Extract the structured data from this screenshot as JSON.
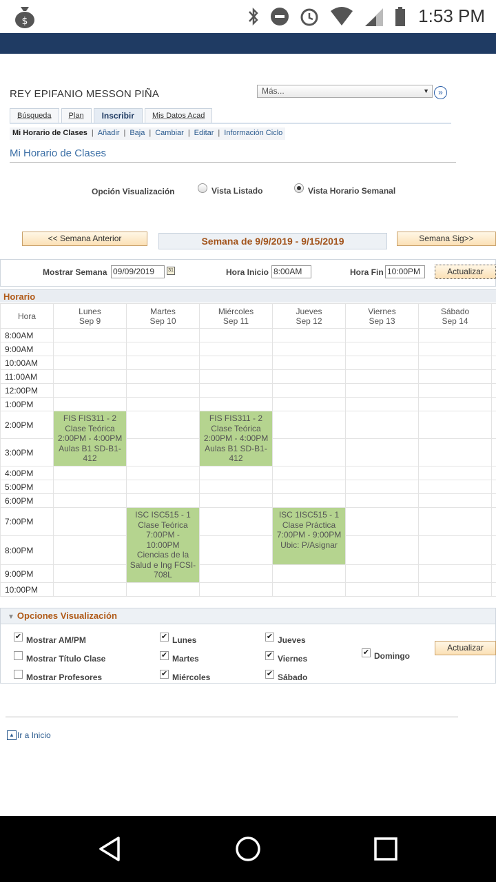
{
  "status_bar": {
    "time": "1:53 PM",
    "icons": [
      "money-bag-icon",
      "bluetooth-icon",
      "do-not-disturb-icon",
      "alarm-icon",
      "wifi-icon",
      "signal-icon",
      "battery-icon"
    ]
  },
  "student": {
    "name": "REY EPIFANIO MESSON PIÑA"
  },
  "mas_select": {
    "value": "Más...",
    "go": "»"
  },
  "tabs": [
    {
      "label": "Búsqueda",
      "active": false
    },
    {
      "label": "Plan",
      "active": false
    },
    {
      "label": "Inscribir",
      "active": true
    },
    {
      "label": "Mis Datos Acad",
      "active": false
    }
  ],
  "subnav": {
    "current": "Mi Horario de Clases",
    "links": [
      "Añadir",
      "Baja",
      "Cambiar",
      "Editar",
      "Información Ciclo"
    ],
    "separator": "|"
  },
  "page_title": "Mi Horario de Clases",
  "view_options": {
    "label": "Opción Visualización",
    "list": "Vista Listado",
    "weekly": "Vista Horario Semanal",
    "selected": "weekly"
  },
  "week_nav": {
    "prev": "<< Semana Anterior",
    "current": "Semana de 9/9/2019 - 9/15/2019",
    "next": "Semana Sig>>"
  },
  "filters": {
    "show_week_label": "Mostrar Semana",
    "show_week_value": "09/09/2019",
    "calendar_glyph": "31",
    "start_label": "Hora Inicio",
    "start_value": "8:00AM",
    "end_label": "Hora Fin",
    "end_value": "10:00PM",
    "update": "Actualizar"
  },
  "schedule": {
    "header": "Horario",
    "hour_col": "Hora",
    "days": [
      {
        "name": "Lunes",
        "date": "Sep 9"
      },
      {
        "name": "Martes",
        "date": "Sep 10"
      },
      {
        "name": "Miércoles",
        "date": "Sep 11"
      },
      {
        "name": "Jueves",
        "date": "Sep 12"
      },
      {
        "name": "Viernes",
        "date": "Sep 13"
      },
      {
        "name": "Sábado",
        "date": "Sep 14"
      }
    ],
    "hours": [
      "8:00AM",
      "9:00AM",
      "10:00AM",
      "11:00AM",
      "12:00PM",
      "1:00PM",
      "2:00PM",
      "3:00PM",
      "4:00PM",
      "5:00PM",
      "6:00PM",
      "7:00PM",
      "8:00PM",
      "9:00PM",
      "10:00PM"
    ],
    "events": [
      {
        "lines": [
          "FIS FIS311 - 2",
          "Clase Teórica",
          "2:00PM - 4:00PM",
          "Aulas B1 SD-B1-",
          "412"
        ]
      },
      {
        "lines": [
          "ISC ISC515 - 1",
          "Clase Teórica",
          "7:00PM -",
          "10:00PM",
          "Ciencias de la",
          "Salud e Ing FCSI-",
          "708L"
        ]
      },
      {
        "lines": [
          "FIS FIS311 - 2",
          "Clase Teórica",
          "2:00PM - 4:00PM",
          "Aulas B1 SD-B1-",
          "412"
        ]
      },
      {
        "lines": [
          "ISC 1ISC515 - 1",
          "Clase Práctica",
          "7:00PM - 9:00PM",
          "Ubic: P/Asignar"
        ]
      }
    ]
  },
  "display_options": {
    "header": "Opciones Visualización",
    "items": [
      {
        "label": "Mostrar AM/PM",
        "checked": true
      },
      {
        "label": "Mostrar Título Clase",
        "checked": false
      },
      {
        "label": "Mostrar Profesores",
        "checked": false
      },
      {
        "label": "Lunes",
        "checked": true
      },
      {
        "label": "Martes",
        "checked": true
      },
      {
        "label": "Miércoles",
        "checked": true
      },
      {
        "label": "Jueves",
        "checked": true
      },
      {
        "label": "Viernes",
        "checked": true
      },
      {
        "label": "Sábado",
        "checked": true
      },
      {
        "label": "Domingo",
        "checked": true
      }
    ],
    "update": "Actualizar"
  },
  "footer": {
    "home_link": "Ir a Inicio"
  }
}
